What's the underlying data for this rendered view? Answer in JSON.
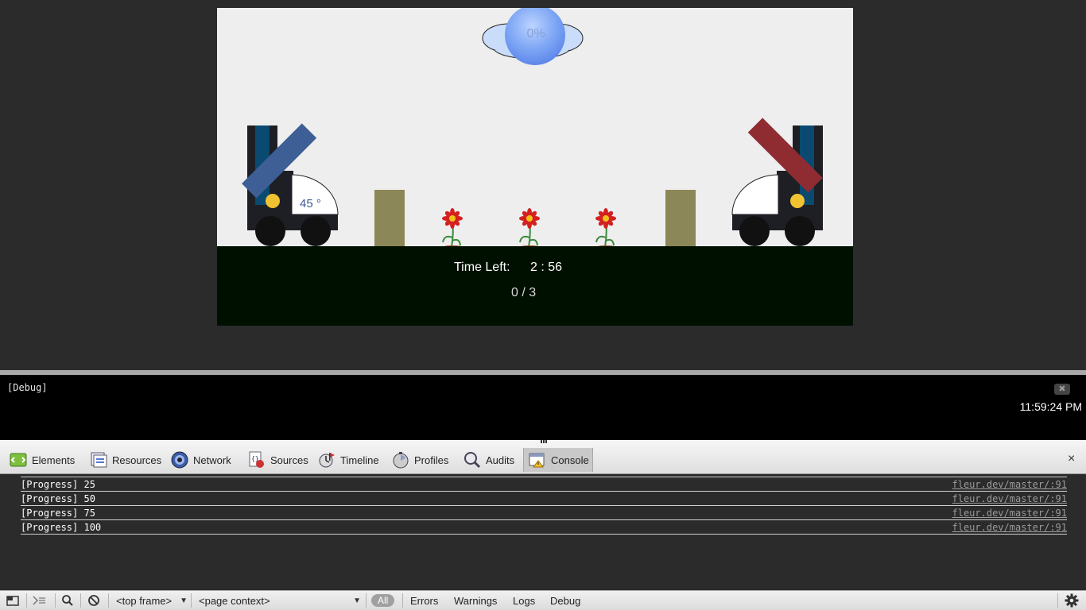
{
  "game": {
    "cloud_progress": "0%",
    "angle": "45 °",
    "time_label": "Time Left:",
    "time_value": "2 : 56",
    "score": "0 / 3",
    "colors": {
      "sky": "#eeeeee",
      "ground": "#001000",
      "player_cannon": "#3d5f96",
      "enemy_cannon": "#8e2c32",
      "tower": "#0a4a70",
      "stone": "#8b8758"
    }
  },
  "debug": {
    "title": "[Debug]",
    "close_icon": "close-icon",
    "clock": "11:59:24 PM"
  },
  "devtools": {
    "tabs": [
      {
        "label": "Elements",
        "icon": "elements-icon"
      },
      {
        "label": "Resources",
        "icon": "resources-icon"
      },
      {
        "label": "Network",
        "icon": "network-icon"
      },
      {
        "label": "Sources",
        "icon": "sources-icon"
      },
      {
        "label": "Timeline",
        "icon": "timeline-icon"
      },
      {
        "label": "Profiles",
        "icon": "profiles-icon"
      },
      {
        "label": "Audits",
        "icon": "audits-icon"
      },
      {
        "label": "Console",
        "icon": "console-icon",
        "active": true
      }
    ],
    "close_glyph": "×",
    "console_lines": [
      {
        "text": "[Progress] 25",
        "source": "fleur.dev/master/:91"
      },
      {
        "text": "[Progress] 50",
        "source": "fleur.dev/master/:91"
      },
      {
        "text": "[Progress] 75",
        "source": "fleur.dev/master/:91"
      },
      {
        "text": "[Progress] 100",
        "source": "fleur.dev/master/:91"
      }
    ],
    "status": {
      "frame": "<top frame>",
      "context": "<page context>",
      "filters": [
        "All",
        "Errors",
        "Warnings",
        "Logs",
        "Debug"
      ]
    }
  }
}
